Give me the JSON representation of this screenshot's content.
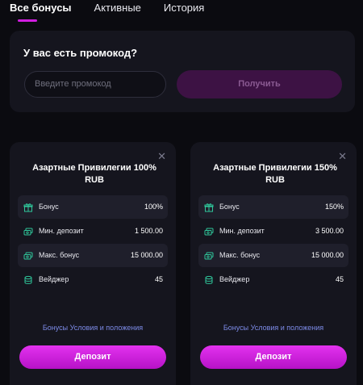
{
  "tabs": {
    "all": "Все бонусы",
    "active": "Активные",
    "history": "История"
  },
  "promo": {
    "title": "У вас есть промокод?",
    "placeholder": "Введите промокод",
    "button": "Получить"
  },
  "cards": [
    {
      "title": "Азартные Привилегии 100% RUB",
      "rows": [
        {
          "icon": "gift-icon",
          "label": "Бонус",
          "value": "100%"
        },
        {
          "icon": "money-icon",
          "label": "Мин. депозит",
          "value": "1 500.00"
        },
        {
          "icon": "money-icon",
          "label": "Макс. бонус",
          "value": "15 000.00"
        },
        {
          "icon": "coins-icon",
          "label": "Вейджер",
          "value": "45"
        }
      ],
      "terms": "Бонусы Условия и положения",
      "button": "Депозит",
      "close": "✕"
    },
    {
      "title": "Азартные Привилегии 150% RUB",
      "rows": [
        {
          "icon": "gift-icon",
          "label": "Бонус",
          "value": "150%"
        },
        {
          "icon": "money-icon",
          "label": "Мин. депозит",
          "value": "3 500.00"
        },
        {
          "icon": "money-icon",
          "label": "Макс. бонус",
          "value": "15 000.00"
        },
        {
          "icon": "coins-icon",
          "label": "Вейджер",
          "value": "45"
        }
      ],
      "terms": "Бонусы Условия и положения",
      "button": "Депозит",
      "close": "✕"
    }
  ],
  "colors": {
    "accent": "#d11ee0",
    "background": "#0b0b10",
    "panel": "#15151e",
    "link": "#7d8be8"
  }
}
